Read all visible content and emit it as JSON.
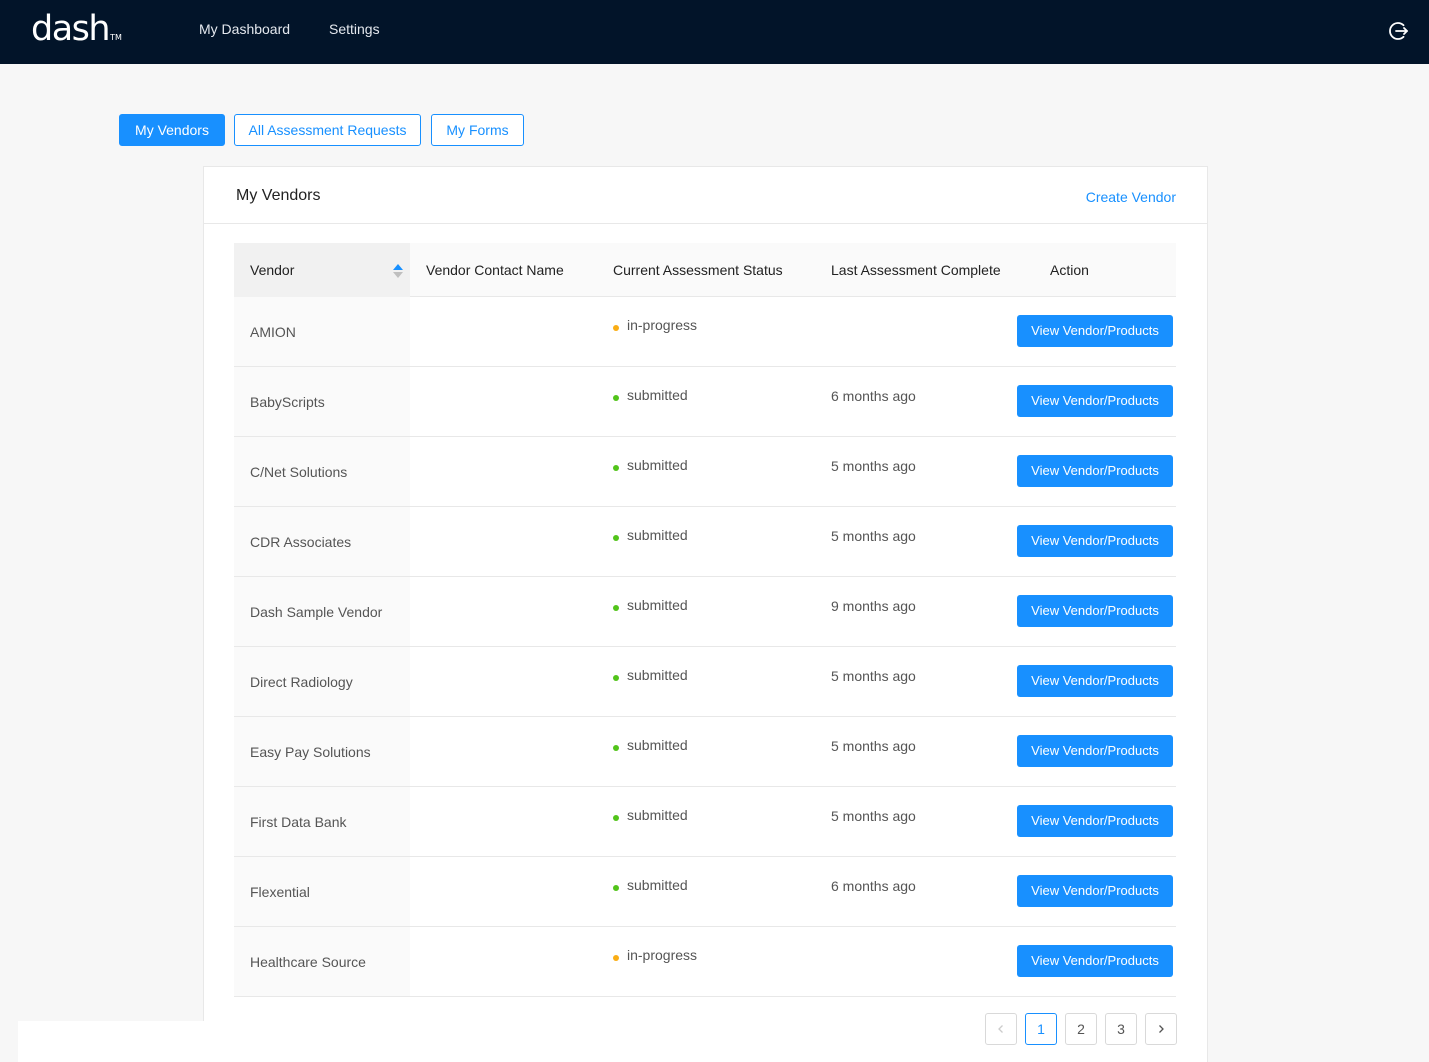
{
  "app": {
    "logo": "dash",
    "logo_tm": "TM",
    "nav": [
      "My Dashboard",
      "Settings"
    ],
    "logout_icon": "logout-icon"
  },
  "tabs": [
    {
      "label": "My Vendors",
      "active": true
    },
    {
      "label": "All Assessment Requests",
      "active": false
    },
    {
      "label": "My Forms",
      "active": false
    }
  ],
  "card": {
    "title": "My Vendors",
    "create_label": "Create Vendor"
  },
  "table": {
    "columns": [
      "Vendor",
      "Vendor Contact Name",
      "Current Assessment Status",
      "Last Assessment Complete",
      "Action"
    ],
    "action_label": "View Vendor/Products",
    "rows": [
      {
        "vendor": "AMION",
        "contact": "",
        "status": "in-progress",
        "status_color": "#faad14",
        "last": ""
      },
      {
        "vendor": "BabyScripts",
        "contact": "",
        "status": "submitted",
        "status_color": "#52c41a",
        "last": "6 months ago"
      },
      {
        "vendor": "C/Net Solutions",
        "contact": "",
        "status": "submitted",
        "status_color": "#52c41a",
        "last": "5 months ago"
      },
      {
        "vendor": "CDR Associates",
        "contact": "",
        "status": "submitted",
        "status_color": "#52c41a",
        "last": "5 months ago"
      },
      {
        "vendor": "Dash Sample Vendor",
        "contact": "",
        "status": "submitted",
        "status_color": "#52c41a",
        "last": "9 months ago"
      },
      {
        "vendor": "Direct Radiology",
        "contact": "",
        "status": "submitted",
        "status_color": "#52c41a",
        "last": "5 months ago"
      },
      {
        "vendor": "Easy Pay Solutions",
        "contact": "",
        "status": "submitted",
        "status_color": "#52c41a",
        "last": "5 months ago"
      },
      {
        "vendor": "First Data Bank",
        "contact": "",
        "status": "submitted",
        "status_color": "#52c41a",
        "last": "5 months ago"
      },
      {
        "vendor": "Flexential",
        "contact": "",
        "status": "submitted",
        "status_color": "#52c41a",
        "last": "6 months ago"
      },
      {
        "vendor": "Healthcare Source",
        "contact": "",
        "status": "in-progress",
        "status_color": "#faad14",
        "last": ""
      }
    ]
  },
  "pagination": {
    "pages": [
      "1",
      "2",
      "3"
    ],
    "current": "1",
    "prev_icon": "chevron-left-icon",
    "next_icon": "chevron-right-icon"
  },
  "colors": {
    "topbar": "#021429",
    "accent": "#1890ff",
    "in_progress": "#faad14",
    "submitted": "#52c41a"
  }
}
